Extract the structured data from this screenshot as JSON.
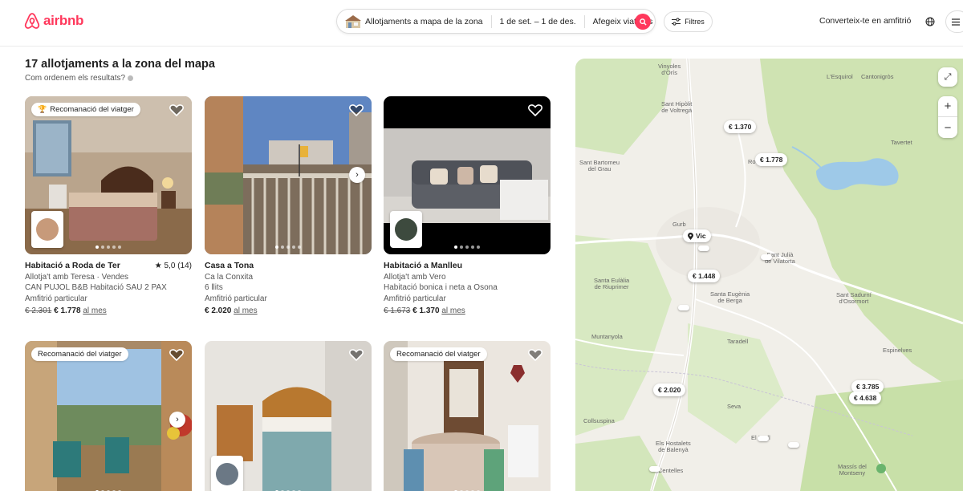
{
  "header": {
    "logo_text": "airbnb",
    "search": {
      "location": "Allotjaments a mapa de la zona",
      "dates": "1 de set. – 1 de des.",
      "guests": "Afegeix viatgers"
    },
    "filters_label": "Filtres",
    "host_link": "Converteix-te en amfitrió"
  },
  "results": {
    "title": "17 allotjaments a la zona del mapa",
    "subtitle": "Com ordenem els resultats?"
  },
  "listings": [
    {
      "badge": "Recomanació del viatger",
      "title": "Habitació a Roda de Ter",
      "rating": "★ 5,0 (14)",
      "line1": "Allotja't amb Teresa · Vendes",
      "line2": "CAN PUJOL B&B Habitació SAU 2 PAX",
      "line3": "Amfitrió particular",
      "old_price": "€ 2.301",
      "price": "€ 1.778",
      "per": "al mes"
    },
    {
      "badge": "",
      "title": "Casa a Tona",
      "rating": "",
      "line1": "Ca la Conxita",
      "line2": "6 llits",
      "line3": "Amfitrió particular",
      "old_price": "",
      "price": "€ 2.020",
      "per": "al mes"
    },
    {
      "badge": "",
      "title": "Habitació a Manlleu",
      "rating": "",
      "line1": "Allotja't amb Vero",
      "line2": "Habitació bonica i neta a Osona",
      "line3": "Amfitrió particular",
      "old_price": "€ 1.673",
      "price": "€ 1.370",
      "per": "al mes"
    },
    {
      "badge": "Recomanació del viatger"
    },
    {
      "badge": ""
    },
    {
      "badge": "Recomanació del viatger"
    }
  ],
  "map": {
    "pins": [
      "€ 1.370",
      "€ 1.778",
      "€ 1.448",
      "€ 2.020",
      "€ 3.785",
      "€ 4.638"
    ],
    "vic_label": "Vic",
    "places": {
      "vinyoles": "Vinyoles\nd'Orís",
      "esquirol": "L'Esquirol",
      "cantonigros": "Cantonigròs",
      "santhipolit": "Sant Hipòlit\nde Voltregà",
      "tavertet": "Tavertet",
      "santbartomeu": "Sant Bartomeu\ndel Grau",
      "gurb": "Gurb",
      "santjulia": "Sant Julià\nde Vilatorta",
      "santaeulalia": "Santa Eulàlia\nde Riuprimer",
      "santaeugenia": "Santa Eugènia\nde Berga",
      "santsadurni": "Sant Sadurní\nd'Osormort",
      "muntanyola": "Muntanyola",
      "taradell": "Taradell",
      "espinelves": "Espinelves",
      "seva": "Seva",
      "collsuspina": "Collsuspina",
      "hostalets": "Els Hostalets\nde Balenyà",
      "brull": "El Brull",
      "massis": "Massís del\nMontseny",
      "centelles": "Centelles",
      "roda": "Roda"
    }
  },
  "colors": {
    "brand": "#ff385c",
    "map_green": "#cfe3b2",
    "map_water": "#9ec9e8"
  }
}
